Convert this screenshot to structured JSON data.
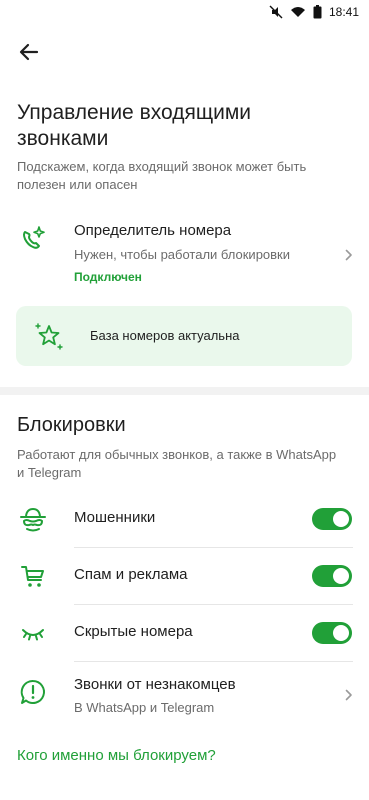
{
  "status_bar": {
    "time": "18:41",
    "icons": [
      "mute-icon",
      "wifi-icon",
      "battery-icon"
    ]
  },
  "header": {
    "back_icon": "arrow-left-icon"
  },
  "page": {
    "title": "Управление входящими звонками",
    "subtitle": "Подскажем, когда входящий звонок может быть полезен или опасен"
  },
  "caller_id": {
    "icon": "phone-sparkle-icon",
    "title": "Определитель номера",
    "subtitle": "Нужен, чтобы работали блокировки",
    "status": "Подключен"
  },
  "database_card": {
    "icon": "star-sparkle-icon",
    "text": "База номеров актуальна"
  },
  "blocking": {
    "title": "Блокировки",
    "subtitle": "Работают для обычных звонков, а также в WhatsApp и Telegram",
    "items": [
      {
        "icon": "fraudster-mask-icon",
        "label": "Мошенники",
        "enabled": true
      },
      {
        "icon": "cart-icon",
        "label": "Спам и реклама",
        "enabled": true
      },
      {
        "icon": "closed-eye-icon",
        "label": "Скрытые номера",
        "enabled": true
      }
    ],
    "strangers": {
      "icon": "chat-alert-icon",
      "title": "Звонки от незнакомцев",
      "subtitle": "В WhatsApp и Telegram"
    }
  },
  "link": {
    "label": "Кого именно мы блокируем?"
  },
  "colors": {
    "accent": "#21a038",
    "card_bg": "#eaf8ec",
    "text": "#1f1f1f",
    "muted": "#6b6b6b"
  }
}
